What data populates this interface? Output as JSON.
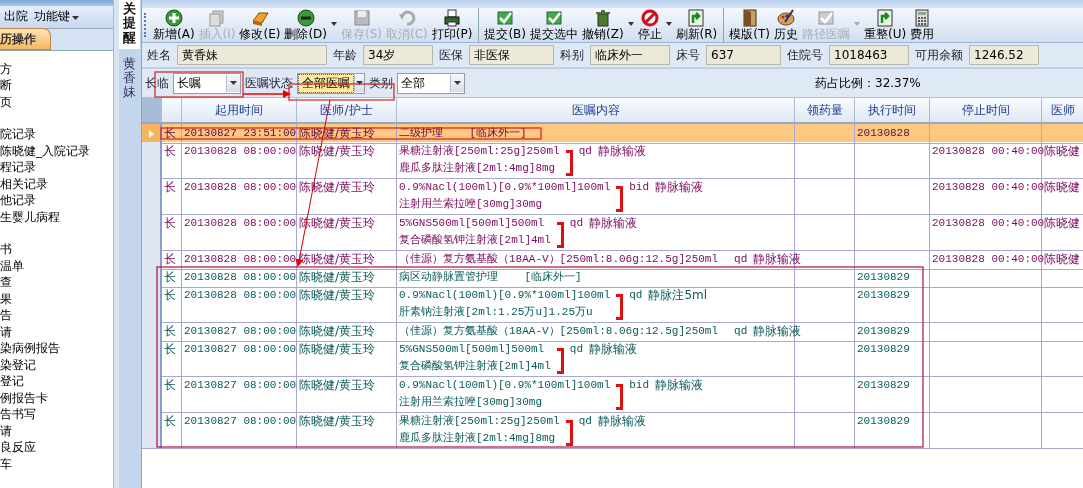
{
  "sidebar": {
    "menu": [
      {
        "label": "出院",
        "dropdown": false
      },
      {
        "label": "功能键",
        "dropdown": true
      }
    ],
    "tab": {
      "label": "历操作"
    },
    "groups": [
      {
        "items": [
          "方",
          "断",
          "页"
        ]
      },
      {
        "items": [
          "院记录",
          "陈晓健_入院记录",
          "程记录",
          "相关记录",
          "他记录",
          "生婴儿病程"
        ]
      },
      {
        "items": [
          "书",
          "温单",
          "查",
          "果",
          "告",
          "请",
          "染病例报告",
          "染登记",
          "登记",
          "例报告卡",
          "告书写",
          "请",
          "良反应",
          "车"
        ]
      }
    ]
  },
  "side_tabs": [
    {
      "label": "关提醒",
      "selected": true
    },
    {
      "label": "黄香妹",
      "selected": false
    }
  ],
  "toolbar": [
    {
      "label": "新增(A)",
      "disabled": false,
      "dropdown": false,
      "separator_before": false
    },
    {
      "label": "插入(I)",
      "disabled": true,
      "dropdown": false,
      "separator_before": false
    },
    {
      "label": "修改(E)",
      "disabled": false,
      "dropdown": false,
      "separator_before": false
    },
    {
      "label": "删除(D)",
      "disabled": false,
      "dropdown": true,
      "separator_before": false
    },
    {
      "label": "保存(S)",
      "disabled": true,
      "dropdown": false,
      "separator_before": false
    },
    {
      "label": "取消(C)",
      "disabled": true,
      "dropdown": false,
      "separator_before": false
    },
    {
      "label": "打印(P)",
      "disabled": false,
      "dropdown": false,
      "separator_before": false
    },
    {
      "label": "提交(B)",
      "disabled": false,
      "dropdown": false,
      "separator_before": true
    },
    {
      "label": "提交选中",
      "disabled": false,
      "dropdown": false,
      "separator_before": false
    },
    {
      "label": "撤销(Z)",
      "disabled": false,
      "dropdown": true,
      "separator_before": false
    },
    {
      "label": "停止",
      "disabled": false,
      "dropdown": true,
      "separator_before": false
    },
    {
      "label": "刷新(R)",
      "disabled": false,
      "dropdown": false,
      "separator_before": false
    },
    {
      "label": "模版(T)",
      "disabled": false,
      "dropdown": false,
      "separator_before": true
    },
    {
      "label": "历史",
      "disabled": false,
      "dropdown": false,
      "separator_before": false
    },
    {
      "label": "路径医嘱",
      "disabled": true,
      "dropdown": true,
      "separator_before": false
    },
    {
      "label": "重整(U)",
      "disabled": false,
      "dropdown": false,
      "separator_before": false
    },
    {
      "label": "费用",
      "disabled": false,
      "dropdown": false,
      "separator_before": false
    }
  ],
  "patient": [
    {
      "label": "姓名",
      "value": "黄香妹"
    },
    {
      "label": "年龄",
      "value": "34岁"
    },
    {
      "label": "医保",
      "value": "非医保"
    },
    {
      "label": "科别",
      "value": "临床外一"
    },
    {
      "label": "床号",
      "value": "637"
    },
    {
      "label": "住院号",
      "value": "1018463"
    },
    {
      "label": "可用余额",
      "value": "1246.52"
    }
  ],
  "filters": [
    {
      "label": "长临",
      "value": "长嘱",
      "highlighted": false
    },
    {
      "label": "医嘱状态",
      "value": "全部医嘱",
      "highlighted": true
    },
    {
      "label": "类别",
      "value": "全部",
      "highlighted": false
    }
  ],
  "drug_ratio": "药占比例：32.37%",
  "table": {
    "columns": [
      "起用时间",
      "医师/护士",
      "医嘱内容",
      "领药量",
      "执行时间",
      "停止时间",
      "医师"
    ],
    "rows": [
      {
        "type": "长",
        "start": "20130827 23:51:00",
        "doctor": "陈晓健/黄玉玲",
        "lines": [
          "二级护理    [临床外一]"
        ],
        "exec": "20130828",
        "selected": true,
        "stopped": true
      },
      {
        "type": "长",
        "start": "20130828 08:00:00",
        "doctor": "陈晓健/黄玉玲",
        "lines": [
          "果糖注射液[250ml:25g]250ml",
          "鹿瓜多肽注射液[2ml:4mg]8mg"
        ],
        "freq": "qd",
        "route": "静脉输液",
        "stop": "20130828 00:40:00",
        "stop_doctor": "陈晓健",
        "selected": false,
        "stopped": true
      },
      {
        "type": "长",
        "start": "20130828 08:00:00",
        "doctor": "陈晓健/黄玉玲",
        "lines": [
          "0.9%Nacl(100ml)[0.9%*100ml]100ml",
          "注射用兰索拉唑[30mg]30mg"
        ],
        "freq": "bid",
        "route": "静脉输液",
        "stop": "20130828 00:40:00",
        "stop_doctor": "陈晓健",
        "selected": false,
        "stopped": true
      },
      {
        "type": "长",
        "start": "20130828 08:00:00",
        "doctor": "陈晓健/黄玉玲",
        "lines": [
          "5%GNS500ml[500ml]500ml",
          "复合磷酸氢钾注射液[2ml]4ml"
        ],
        "freq": "qd",
        "route": "静脉输液",
        "stop": "20130828 00:40:00",
        "stop_doctor": "陈晓健",
        "selected": false,
        "stopped": true
      },
      {
        "type": "长",
        "start": "20130828 08:00:00",
        "doctor": "陈晓健/黄玉玲",
        "lines": [
          "（佳源）复方氨基酸（18AA-V）[250ml:8.06g:12.5g]250ml"
        ],
        "freq": "qd",
        "route": "静脉输液",
        "stop": "20130828 00:40:00",
        "stop_doctor": "陈晓健",
        "selected": false,
        "stopped": true
      },
      {
        "type": "长",
        "start": "20130828 08:00:00",
        "doctor": "陈晓健/黄玉玲",
        "lines": [
          "病区动静脉置管护理    [临床外一]"
        ],
        "exec": "20130829",
        "selected": false,
        "stopped": false
      },
      {
        "type": "长",
        "start": "20130828 08:00:00",
        "doctor": "陈晓健/黄玉玲",
        "lines": [
          "0.9%Nacl(100ml)[0.9%*100ml]100ml",
          "肝素钠注射液[2ml:1.25万u]1.25万u"
        ],
        "freq": "qd",
        "route": "静脉注5ml",
        "exec": "20130829",
        "selected": false,
        "stopped": false
      },
      {
        "type": "长",
        "start": "20130827 08:00:00",
        "doctor": "陈晓健/黄玉玲",
        "lines": [
          "（佳源）复方氨基酸（18AA-V）[250ml:8.06g:12.5g]250ml"
        ],
        "freq": "qd",
        "route": "静脉输液",
        "exec": "20130829",
        "selected": false,
        "stopped": false
      },
      {
        "type": "长",
        "start": "20130827 08:00:00",
        "doctor": "陈晓健/黄玉玲",
        "lines": [
          "5%GNS500ml[500ml]500ml",
          "复合磷酸氢钾注射液[2ml]4ml"
        ],
        "freq": "qd",
        "route": "静脉输液",
        "exec": "20130829",
        "selected": false,
        "stopped": false
      },
      {
        "type": "长",
        "start": "20130827 08:00:00",
        "doctor": "陈晓健/黄玉玲",
        "lines": [
          "0.9%Nacl(100ml)[0.9%*100ml]100ml",
          "注射用兰索拉唑[30mg]30mg"
        ],
        "freq": "bid",
        "route": "静脉输液",
        "exec": "20130829",
        "selected": false,
        "stopped": false
      },
      {
        "type": "长",
        "start": "20130827 08:00:00",
        "doctor": "陈晓健/黄玉玲",
        "lines": [
          "果糖注射液[250ml:25g]250ml",
          "鹿瓜多肽注射液[2ml:4mg]8mg"
        ],
        "freq": "qd",
        "route": "静脉输液",
        "exec": "20130829",
        "selected": false,
        "stopped": false
      }
    ]
  }
}
